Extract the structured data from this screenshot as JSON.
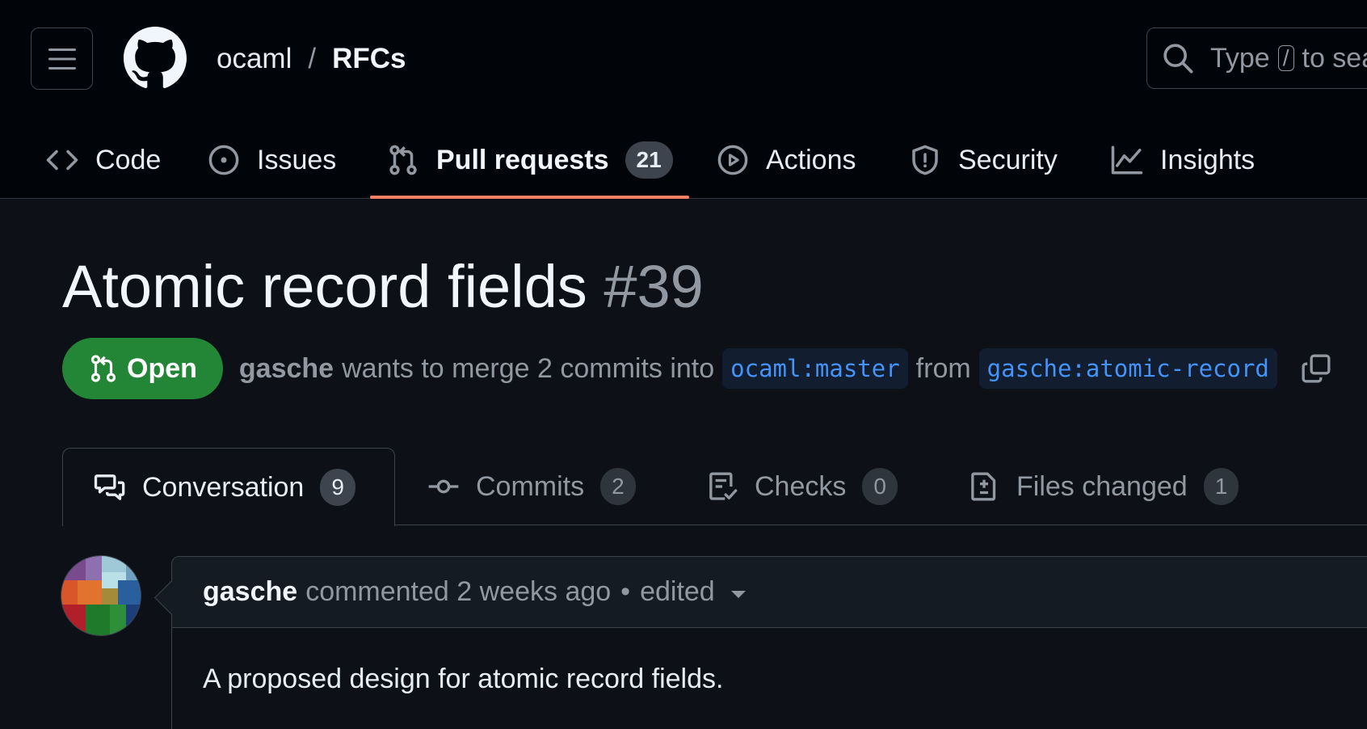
{
  "header": {
    "owner": "ocaml",
    "separator": "/",
    "repo": "RFCs",
    "search": {
      "before": "Type",
      "key": "/",
      "after": "to search"
    }
  },
  "repo_nav": [
    {
      "label": "Code",
      "icon": "code-icon"
    },
    {
      "label": "Issues",
      "icon": "issue-opened-icon"
    },
    {
      "label": "Pull requests",
      "icon": "git-pull-request-icon",
      "count": "21",
      "active": true
    },
    {
      "label": "Actions",
      "icon": "play-icon"
    },
    {
      "label": "Security",
      "icon": "shield-icon"
    },
    {
      "label": "Insights",
      "icon": "graph-icon"
    }
  ],
  "pr": {
    "title": "Atomic record fields",
    "number": "#39",
    "state": "Open",
    "author": "gasche",
    "merge_text": "wants to merge 2 commits into",
    "base_branch": "ocaml:master",
    "from_text": "from",
    "head_branch": "gasche:atomic-record"
  },
  "tabs": [
    {
      "label": "Conversation",
      "count": "9",
      "icon": "comment-discussion-icon",
      "selected": true
    },
    {
      "label": "Commits",
      "count": "2",
      "icon": "git-commit-icon"
    },
    {
      "label": "Checks",
      "count": "0",
      "icon": "checklist-icon"
    },
    {
      "label": "Files changed",
      "count": "1",
      "icon": "file-diff-icon"
    }
  ],
  "comment": {
    "author": "gasche",
    "action": "commented 2 weeks ago",
    "dot": "•",
    "edited": "edited",
    "body": "A proposed design for atomic record fields."
  },
  "colors": {
    "accent_underline": "#f78166",
    "open_badge": "#238636",
    "branch_text": "#4493f8"
  }
}
